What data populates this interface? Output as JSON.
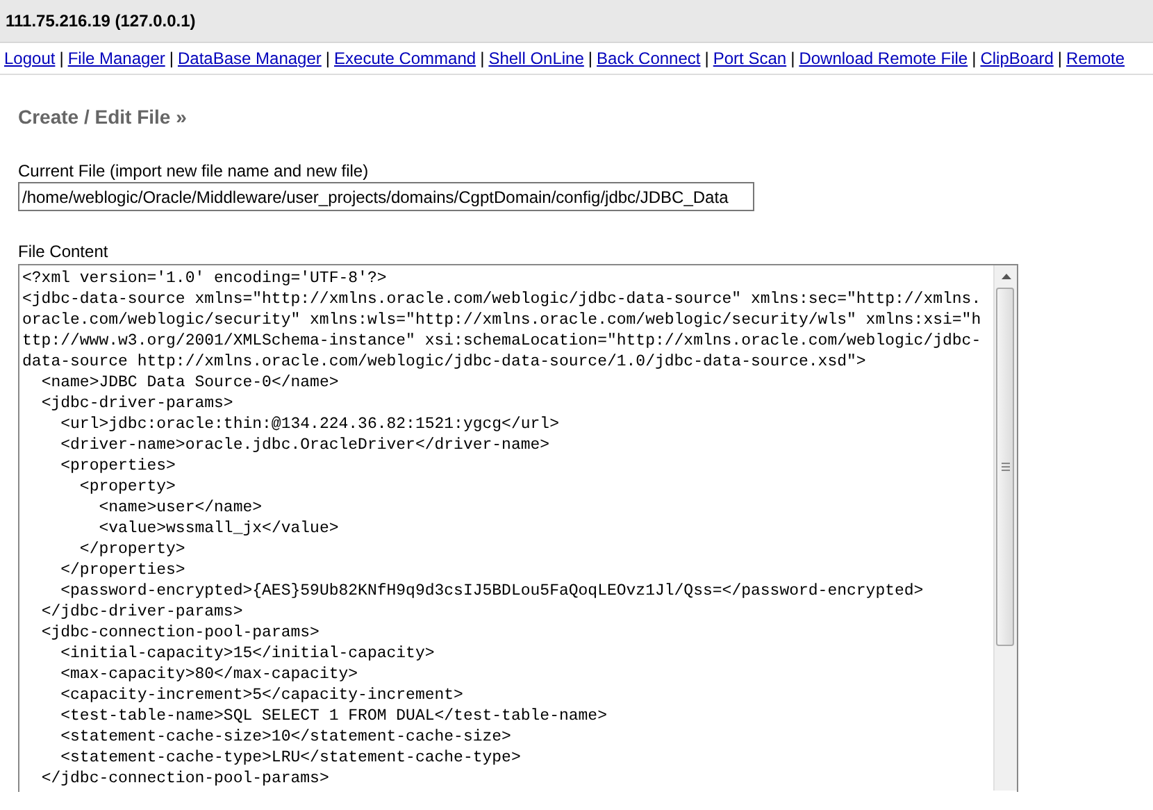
{
  "header": {
    "title": "111.75.216.19 (127.0.0.1)"
  },
  "nav": {
    "links": [
      "Logout",
      "File Manager",
      "DataBase Manager",
      "Execute Command",
      "Shell OnLine",
      "Back Connect",
      "Port Scan",
      "Download Remote File",
      "ClipBoard",
      "Remote"
    ],
    "separator": "|"
  },
  "section_title": "Create / Edit File »",
  "current_file": {
    "label": "Current File (import new file name and new file)",
    "value": "/home/weblogic/Oracle/Middleware/user_projects/domains/CgptDomain/config/jdbc/JDBC_Data"
  },
  "file_content": {
    "label": "File Content",
    "lines": [
      "<?xml version='1.0' encoding='UTF-8'?>",
      "<jdbc-data-source xmlns=\"http://xmlns.oracle.com/weblogic/jdbc-data-source\" xmlns:sec=\"http://xmlns.oracle.com/weblogic/security\" xmlns:wls=\"http://xmlns.oracle.com/weblogic/security/wls\" xmlns:xsi=\"http://www.w3.org/2001/XMLSchema-instance\" xsi:schemaLocation=\"http://xmlns.oracle.com/weblogic/jdbc-data-source http://xmlns.oracle.com/weblogic/jdbc-data-source/1.0/jdbc-data-source.xsd\">",
      "  <name>JDBC Data Source-0</name>",
      "  <jdbc-driver-params>",
      "    <url>jdbc:oracle:thin:@134.224.36.82:1521:ygcg</url>",
      "    <driver-name>oracle.jdbc.OracleDriver</driver-name>",
      "    <properties>",
      "      <property>",
      "        <name>user</name>",
      "        <value>wssmall_jx</value>",
      "      </property>",
      "    </properties>",
      "    <password-encrypted>{AES}59Ub82KNfH9q9d3csIJ5BDLou5FaQoqLEOvz1Jl/Qss=</password-encrypted>",
      "  </jdbc-driver-params>",
      "  <jdbc-connection-pool-params>",
      "    <initial-capacity>15</initial-capacity>",
      "    <max-capacity>80</max-capacity>",
      "    <capacity-increment>5</capacity-increment>",
      "    <test-table-name>SQL SELECT 1 FROM DUAL</test-table-name>",
      "    <statement-cache-size>10</statement-cache-size>",
      "    <statement-cache-type>LRU</statement-cache-type>",
      "  </jdbc-connection-pool-params>"
    ]
  }
}
